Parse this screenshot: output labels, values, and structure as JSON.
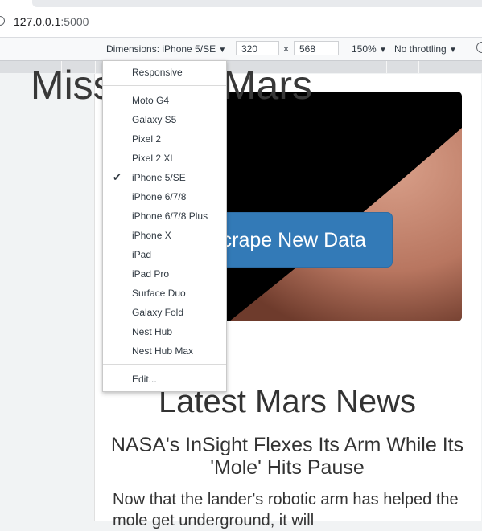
{
  "address_bar": {
    "host": "127.0.0.1",
    "port": ":5000"
  },
  "devtools_toolbar": {
    "dimensions_label": "Dimensions: iPhone 5/SE",
    "width_value": "320",
    "times": "×",
    "height_value": "568",
    "zoom": "150%",
    "throttling": "No throttling",
    "arrow": "▼"
  },
  "device_menu": {
    "responsive": "Responsive",
    "devices": [
      "Moto G4",
      "Galaxy S5",
      "Pixel 2",
      "Pixel 2 XL",
      "iPhone 5/SE",
      "iPhone 6/7/8",
      "iPhone 6/7/8 Plus",
      "iPhone X",
      "iPad",
      "iPad Pro",
      "Surface Duo",
      "Galaxy Fold",
      "Nest Hub",
      "Nest Hub Max"
    ],
    "selected": "iPhone 5/SE",
    "check": "✔",
    "edit": "Edit..."
  },
  "page": {
    "hero_title": "Mission to Mars",
    "scrape_button": "Scrape New Data",
    "news_heading": "Latest Mars News",
    "news_title": "NASA's InSight Flexes Its Arm While Its 'Mole' Hits Pause",
    "news_paragraph": "Now that the lander's robotic arm has helped the mole get underground, it will"
  },
  "colors": {
    "button_blue": "#337ab7",
    "hero_bg": "#000000",
    "mars": "#c98a75"
  }
}
